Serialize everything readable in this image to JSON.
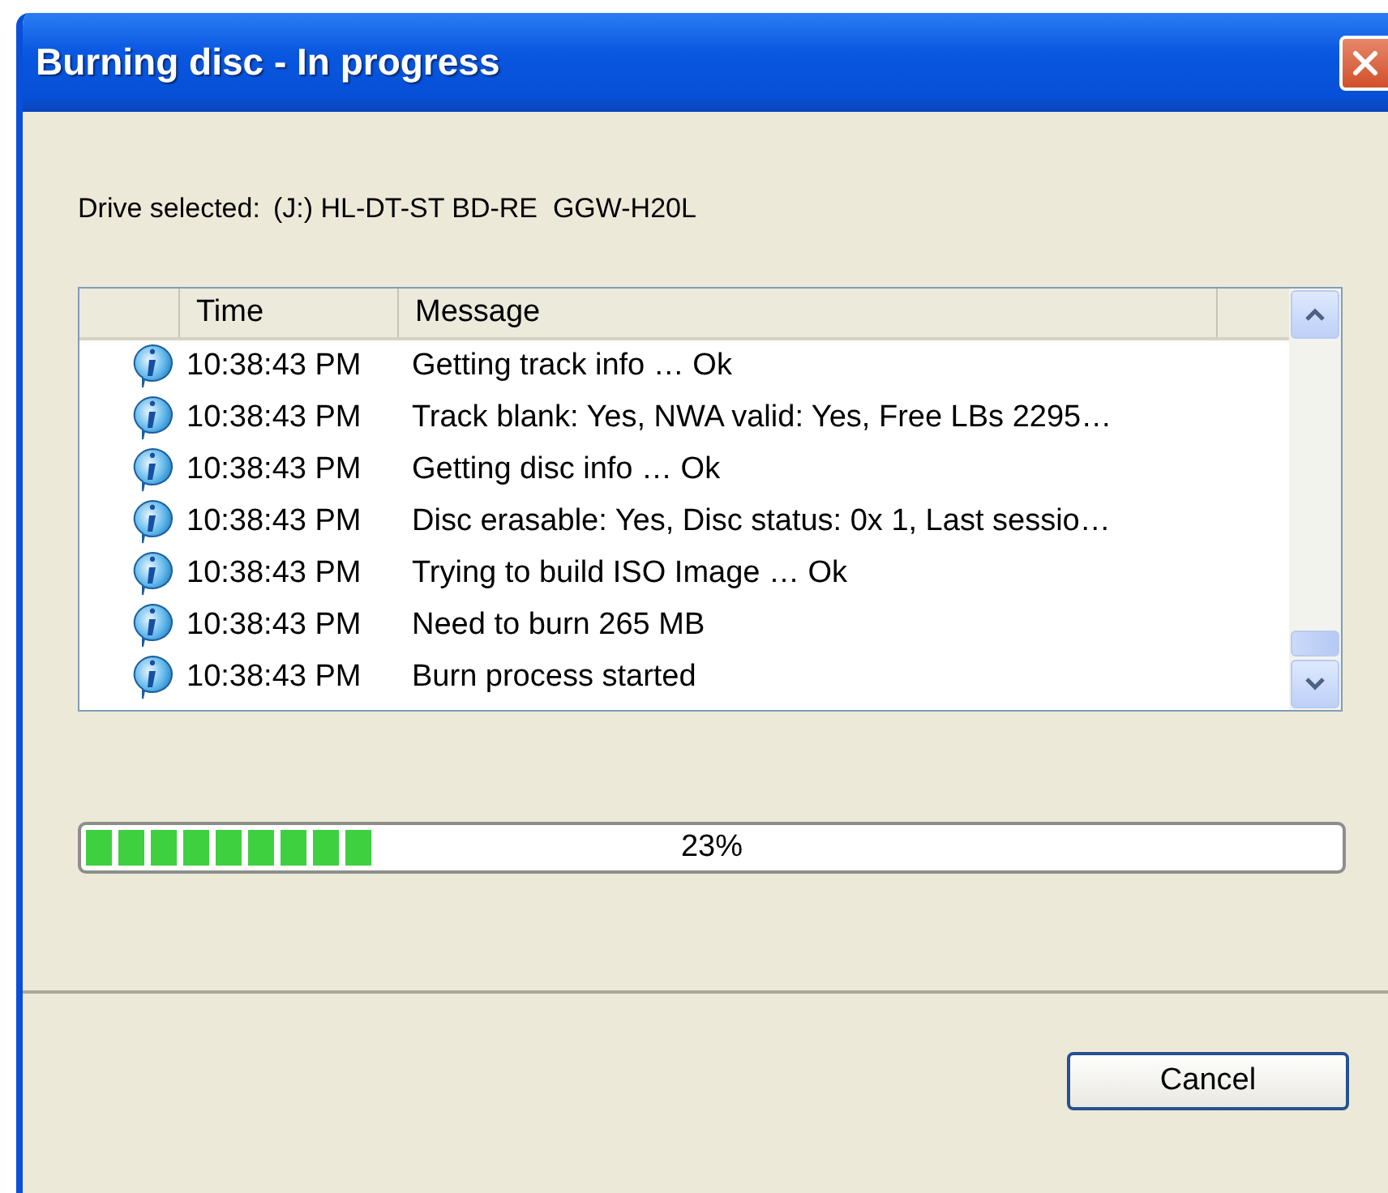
{
  "window": {
    "title": "Burning disc - In progress"
  },
  "drive": {
    "label": "Drive selected:",
    "value": "(J:) HL-DT-ST BD-RE  GGW-H20L"
  },
  "log": {
    "columns": [
      "Time",
      "Message"
    ],
    "rows": [
      {
        "time": "10:38:43 PM",
        "message": "Getting track info … Ok"
      },
      {
        "time": "10:38:43 PM",
        "message": "Track blank: Yes, NWA valid: Yes, Free LBs 2295…"
      },
      {
        "time": "10:38:43 PM",
        "message": "Getting disc info … Ok"
      },
      {
        "time": "10:38:43 PM",
        "message": "Disc erasable: Yes, Disc status: 0x 1, Last sessio…"
      },
      {
        "time": "10:38:43 PM",
        "message": "Trying to build ISO Image … Ok"
      },
      {
        "time": "10:38:43 PM",
        "message": "Need to burn 265 MB"
      },
      {
        "time": "10:38:43 PM",
        "message": "Burn process started"
      }
    ]
  },
  "progress": {
    "level": 0.23,
    "reading": "23%"
  },
  "buttons": [
    "Cancel"
  ]
}
